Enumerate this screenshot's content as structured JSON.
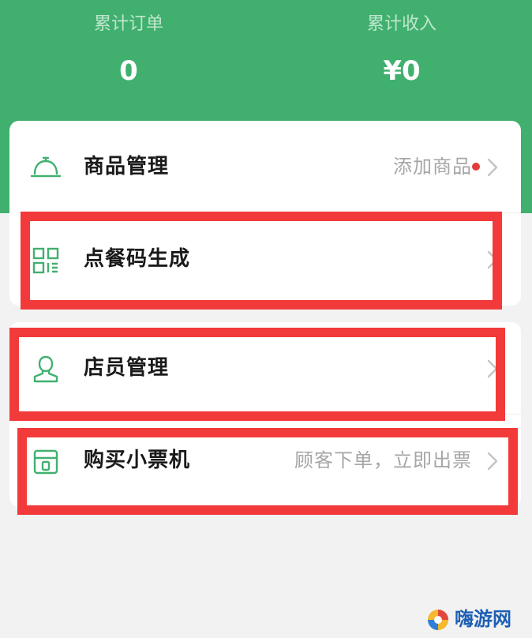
{
  "colors": {
    "brand_green": "#41b06f",
    "highlight_red": "#f23a3a",
    "badge_red": "#e23c3c",
    "hint_gray": "#a6a6a6"
  },
  "stats": {
    "orders": {
      "label": "累计订单",
      "value": "0"
    },
    "income": {
      "label": "累计收入",
      "value": "¥0"
    }
  },
  "menu": [
    {
      "label": "商品管理",
      "hint": "添加商品",
      "icon": "bell-cloche-icon",
      "badge": true
    },
    {
      "label": "点餐码生成",
      "hint": "",
      "icon": "qr-code-icon",
      "badge": false
    },
    {
      "label": "店员管理",
      "hint": "",
      "icon": "person-icon",
      "badge": false
    },
    {
      "label": "购买小票机",
      "hint": "顾客下单，立即出票",
      "icon": "printer-box-icon",
      "badge": false
    }
  ],
  "watermark": {
    "text": "嗨游网"
  }
}
